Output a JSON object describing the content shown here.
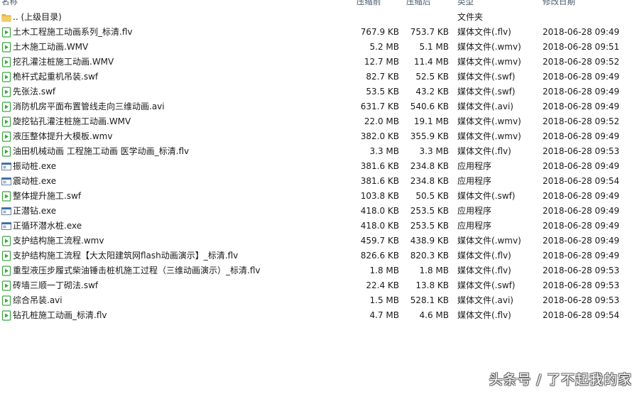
{
  "columns": {
    "name": "名称",
    "compressed": "压缩前",
    "size": "压缩后",
    "type": "类型",
    "modified": "修改日期"
  },
  "parent": {
    "name": ".. (上级目录)",
    "type": "文件夹",
    "icon": "folder-icon"
  },
  "files": [
    {
      "name": "土木工程施工动画系列_标清.flv",
      "comp": "767.9 KB",
      "size": "753.7 KB",
      "type": "媒体文件(.flv)",
      "date": "2018-06-28 09:49",
      "icon": "media-file-icon"
    },
    {
      "name": "土木施工动画.WMV",
      "comp": "5.2 MB",
      "size": "5.1 MB",
      "type": "媒体文件(.wmv)",
      "date": "2018-06-28 09:51",
      "icon": "media-file-icon"
    },
    {
      "name": "挖孔灌注桩施工动画.WMV",
      "comp": "12.7 MB",
      "size": "11.4 MB",
      "type": "媒体文件(.wmv)",
      "date": "2018-06-28 09:52",
      "icon": "media-file-icon"
    },
    {
      "name": "桅杆式起重机吊装.swf",
      "comp": "82.7 KB",
      "size": "52.5 KB",
      "type": "媒体文件(.swf)",
      "date": "2018-06-28 09:49",
      "icon": "media-file-icon"
    },
    {
      "name": "先张法.swf",
      "comp": "53.5 KB",
      "size": "43.2 KB",
      "type": "媒体文件(.swf)",
      "date": "2018-06-28 09:49",
      "icon": "media-file-icon"
    },
    {
      "name": "消防机房平面布置管线走向三维动画.avi",
      "comp": "631.7 KB",
      "size": "540.6 KB",
      "type": "媒体文件(.avi)",
      "date": "2018-06-28 09:49",
      "icon": "media-file-icon"
    },
    {
      "name": "旋挖钻孔灌注桩施工动画.WMV",
      "comp": "22.0 MB",
      "size": "19.1 MB",
      "type": "媒体文件(.wmv)",
      "date": "2018-06-28 09:52",
      "icon": "media-file-icon"
    },
    {
      "name": "液压整体提升大模板.wmv",
      "comp": "382.0 KB",
      "size": "355.9 KB",
      "type": "媒体文件(.wmv)",
      "date": "2018-06-28 09:49",
      "icon": "media-file-icon"
    },
    {
      "name": "油田机械动画 工程施工动画  医学动画_标清.flv",
      "comp": "3.3 MB",
      "size": "3.3 MB",
      "type": "媒体文件(.flv)",
      "date": "2018-06-28 09:53",
      "icon": "media-file-icon"
    },
    {
      "name": "振动桩.exe",
      "comp": "381.6 KB",
      "size": "234.8 KB",
      "type": "应用程序",
      "date": "2018-06-28 09:49",
      "icon": "application-icon"
    },
    {
      "name": "震动桩.exe",
      "comp": "381.6 KB",
      "size": "234.8 KB",
      "type": "应用程序",
      "date": "2018-06-28 09:54",
      "icon": "application-icon"
    },
    {
      "name": "整体提升施工.swf",
      "comp": "103.8 KB",
      "size": "50.5 KB",
      "type": "媒体文件(.swf)",
      "date": "2018-06-28 09:49",
      "icon": "media-file-icon"
    },
    {
      "name": "正潜钻.exe",
      "comp": "418.0 KB",
      "size": "253.5 KB",
      "type": "应用程序",
      "date": "2018-06-28 09:49",
      "icon": "application-icon"
    },
    {
      "name": "正循环潜水桩.exe",
      "comp": "418.0 KB",
      "size": "253.5 KB",
      "type": "应用程序",
      "date": "2018-06-28 09:49",
      "icon": "application-icon"
    },
    {
      "name": "支护结构施工流程.wmv",
      "comp": "459.7 KB",
      "size": "438.9 KB",
      "type": "媒体文件(.wmv)",
      "date": "2018-06-28 09:49",
      "icon": "media-file-icon"
    },
    {
      "name": "支护结构施工流程【大太阳建筑网flash动画演示】_标清.flv",
      "comp": "826.6 KB",
      "size": "820.3 KB",
      "type": "媒体文件(.flv)",
      "date": "2018-06-28 09:49",
      "icon": "media-file-icon"
    },
    {
      "name": "重型液压步履式柴油锤击桩机施工过程（三维动画演示）_标清.flv",
      "comp": "1.8 MB",
      "size": "1.8 MB",
      "type": "媒体文件(.flv)",
      "date": "2018-06-28 09:53",
      "icon": "media-file-icon"
    },
    {
      "name": "砖墙三顺一丁砌法.swf",
      "comp": "22.4 KB",
      "size": "13.8 KB",
      "type": "媒体文件(.swf)",
      "date": "2018-06-28 09:53",
      "icon": "media-file-icon"
    },
    {
      "name": "综合吊装.avi",
      "comp": "1.5 MB",
      "size": "528.1 KB",
      "type": "媒体文件(.avi)",
      "date": "2018-06-28 09:53",
      "icon": "media-file-icon"
    },
    {
      "name": "钻孔桩施工动画_标清.flv",
      "comp": "4.7 MB",
      "size": "4.6 MB",
      "type": "媒体文件(.flv)",
      "date": "2018-06-28 09:54",
      "icon": "media-file-icon"
    }
  ],
  "watermark": "头条号 / 了不起我的家",
  "colors": {
    "media_icon": "#3aa640",
    "app_icon": "#3b6ea8",
    "folder_icon": "#e8b84a",
    "header_text": "#4a5a6a"
  }
}
